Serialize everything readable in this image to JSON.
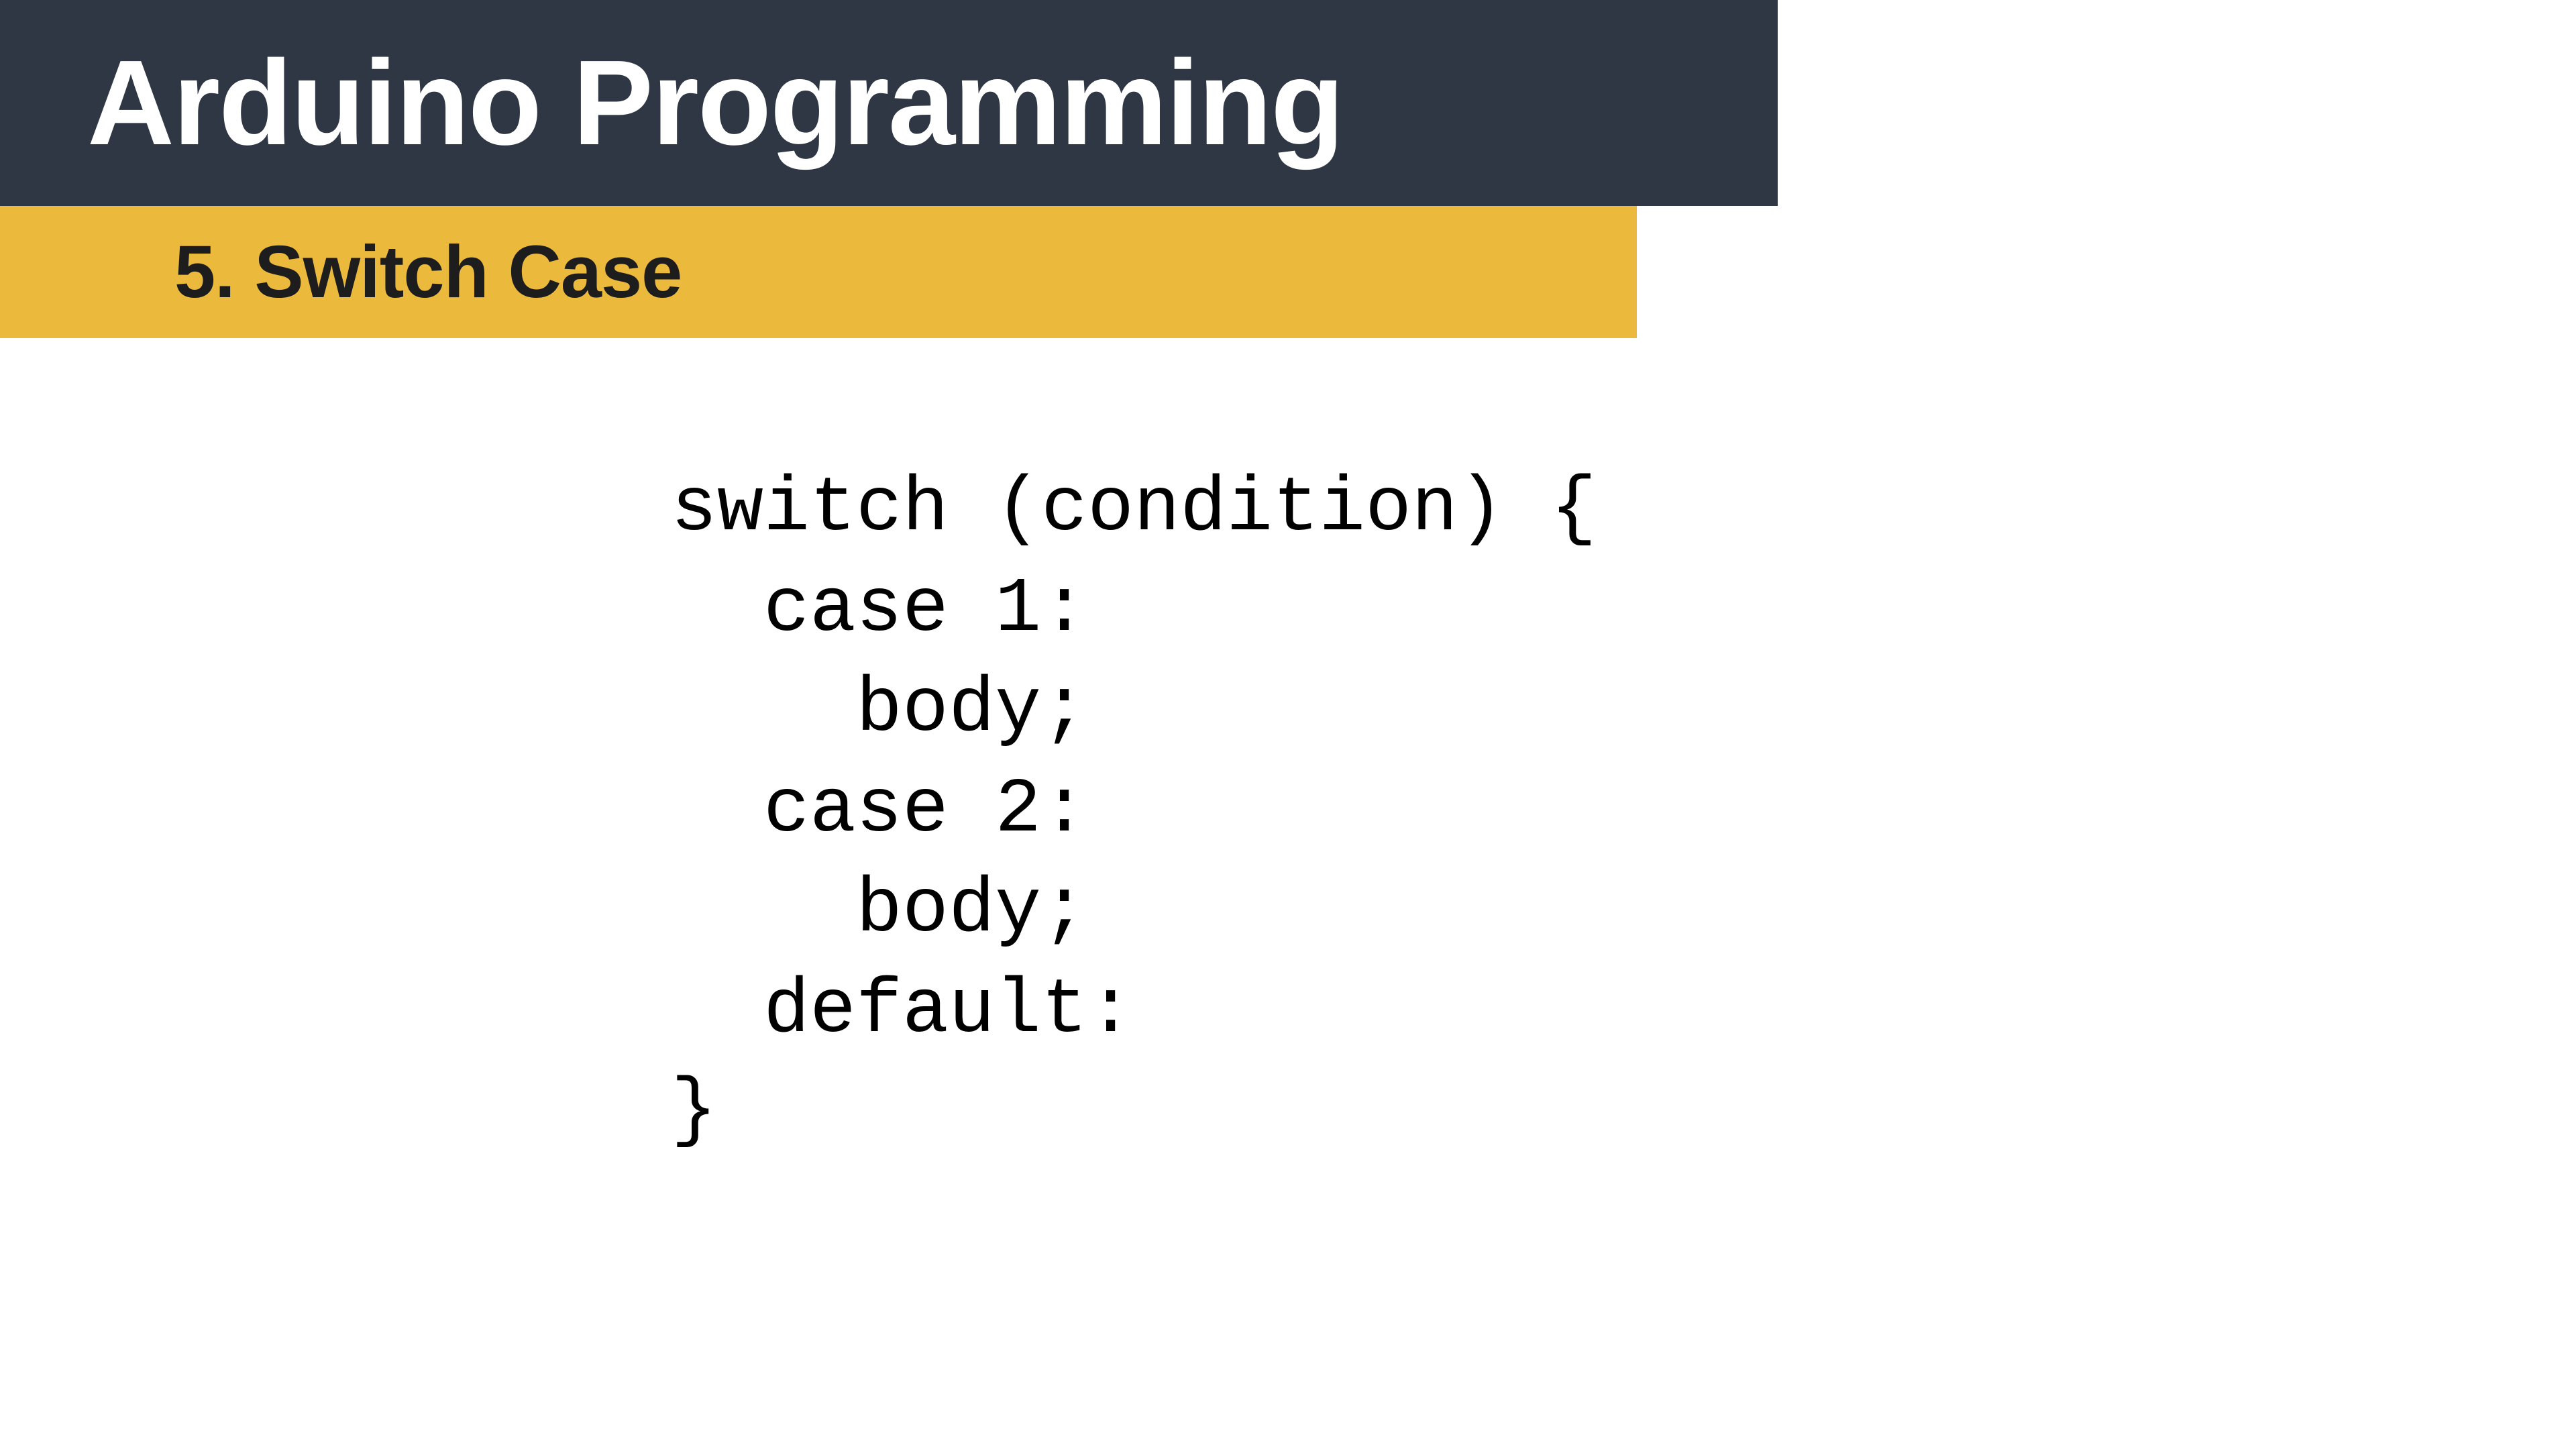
{
  "header": {
    "title": "Arduino Programming",
    "subtitle": "5. Switch Case"
  },
  "code": {
    "line1": "switch (condition) {",
    "line2": "  case 1:",
    "line3": "    body;",
    "line4": "  case 2:",
    "line5": "    body;",
    "line6": "  default:",
    "line7": "}"
  }
}
